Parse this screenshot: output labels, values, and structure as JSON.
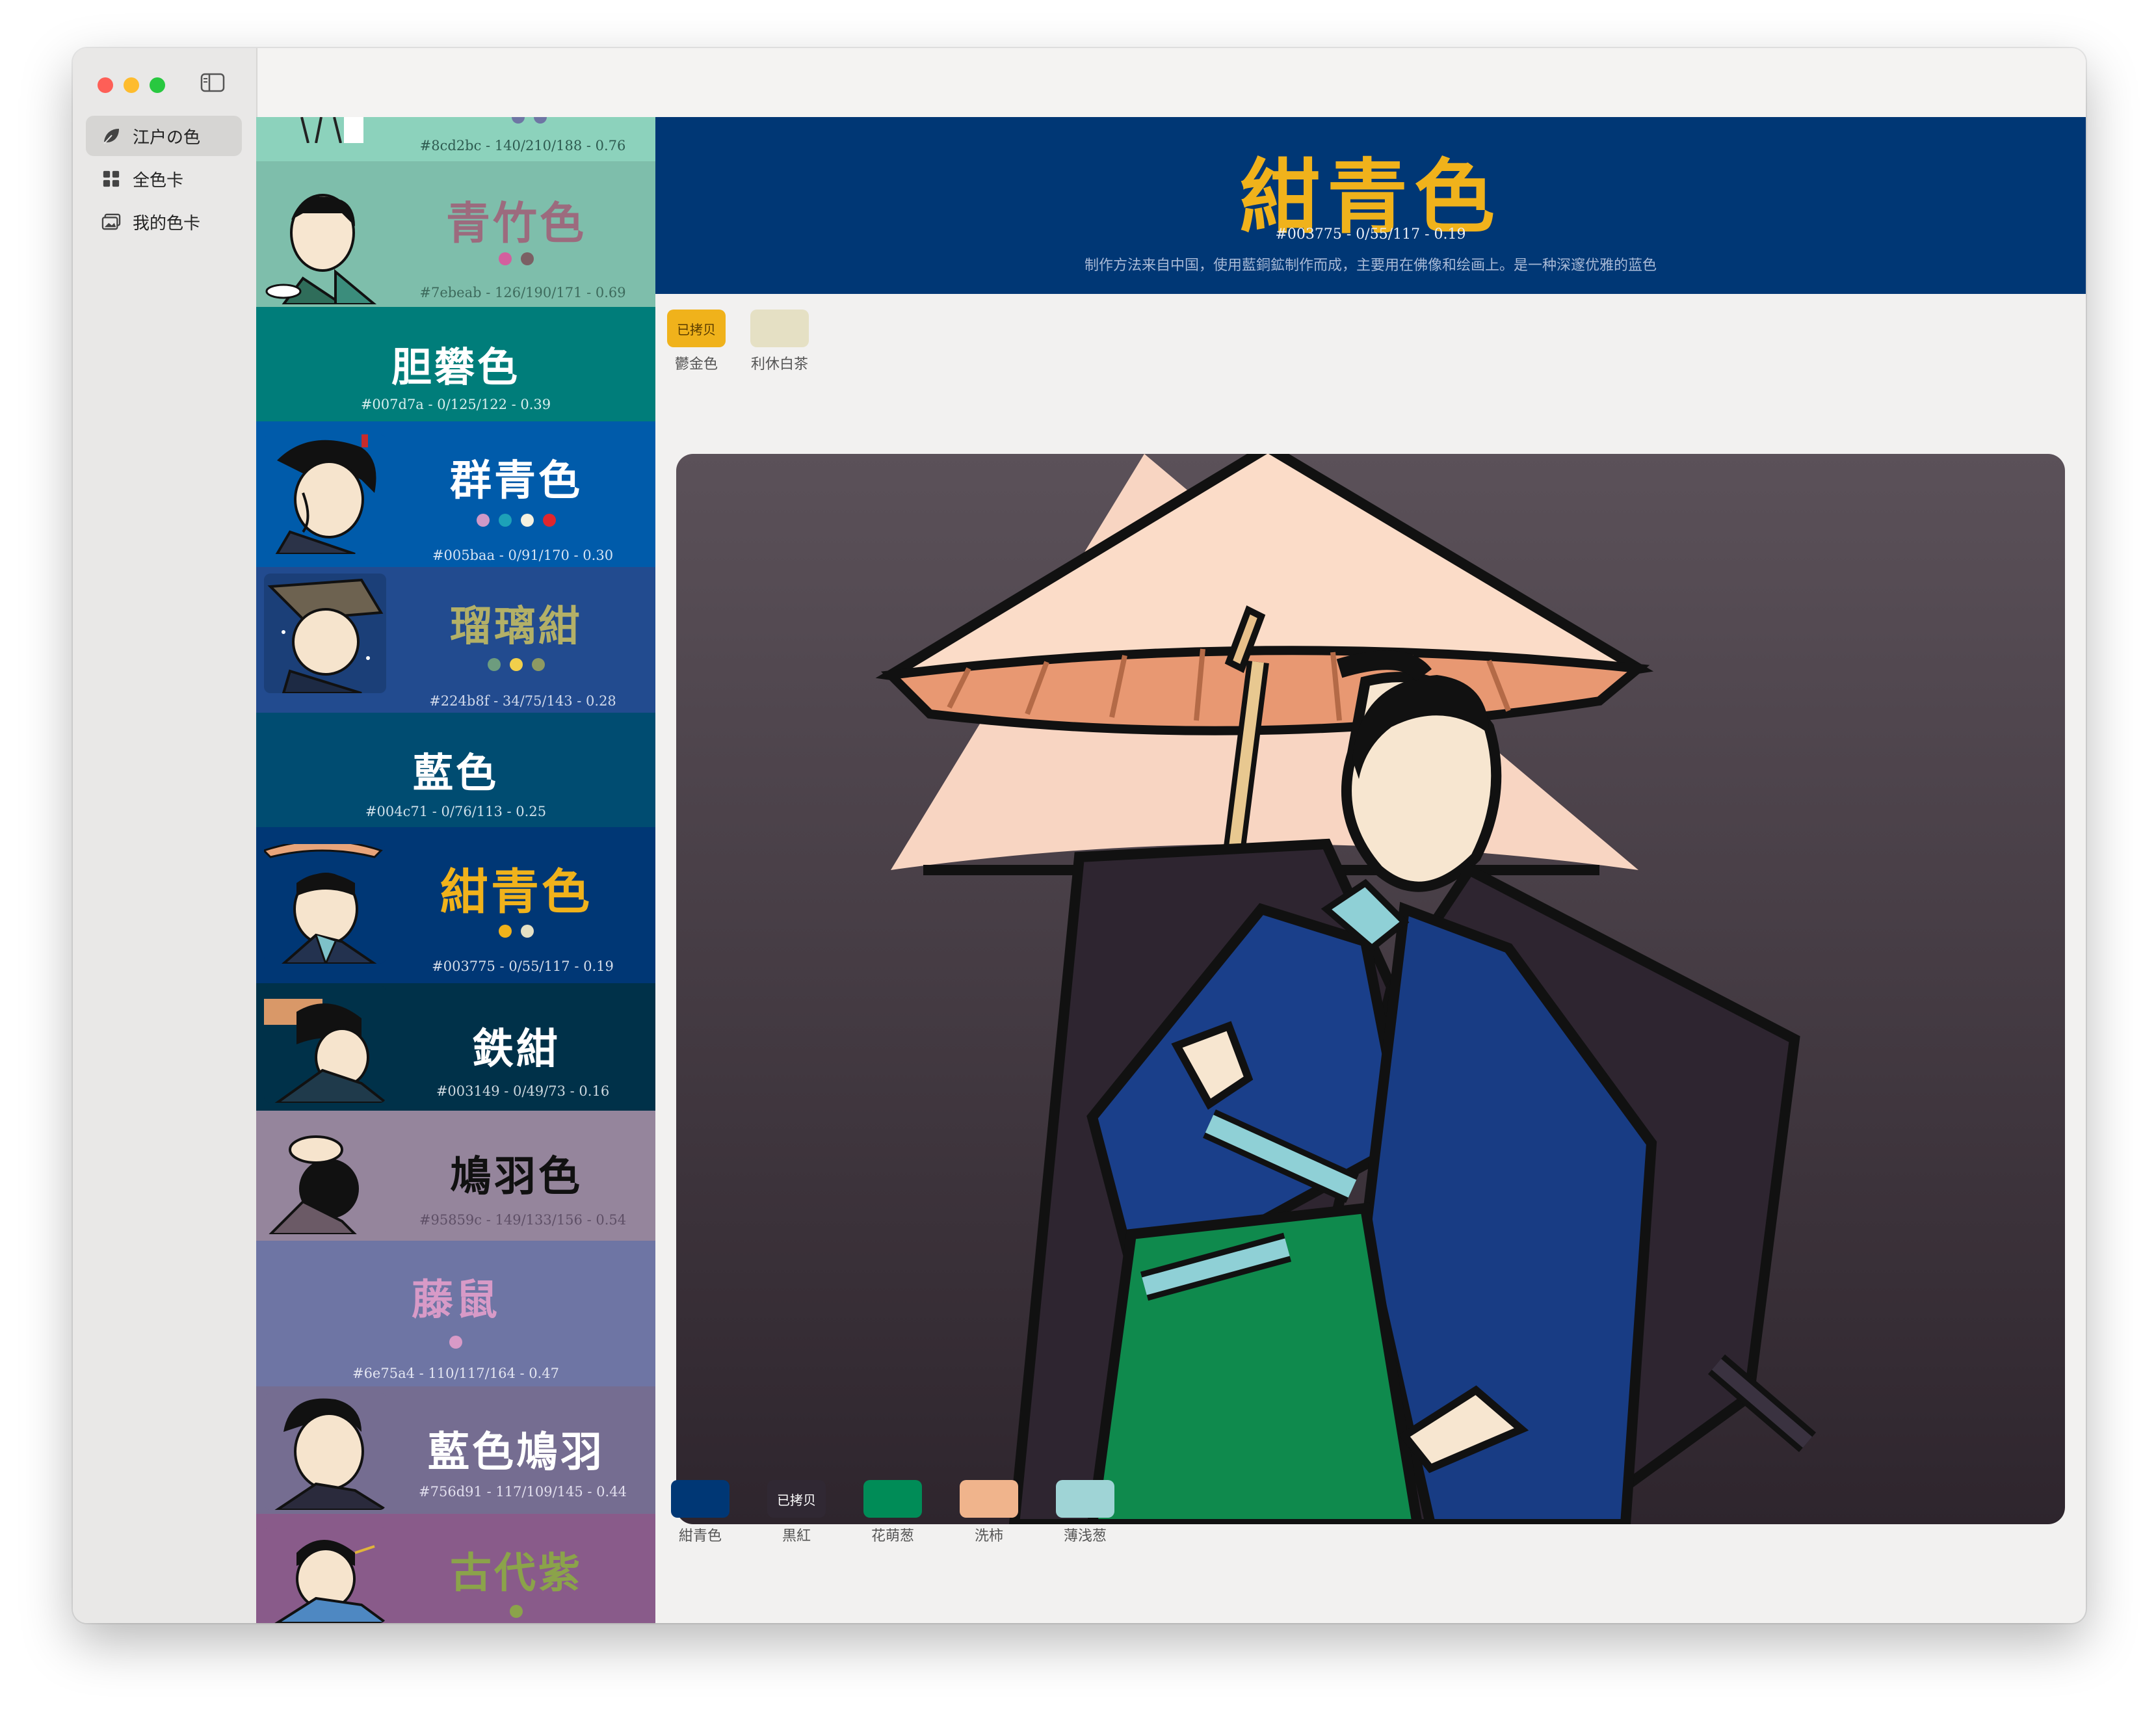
{
  "sidebar": {
    "items": [
      {
        "label": "江户の色",
        "icon": "leaf-icon",
        "active": true
      },
      {
        "label": "全色卡",
        "icon": "grid-icon",
        "active": false
      },
      {
        "label": "我的色卡",
        "icon": "photos-icon",
        "active": false
      }
    ]
  },
  "colors": {
    "list": [
      {
        "meta": "#8cd2bc - 140/210/188 - 0.76"
      },
      {
        "name": "青竹色",
        "meta": "#7ebeab - 126/190/171 - 0.69"
      },
      {
        "name": "胆礬色",
        "meta": "#007d7a - 0/125/122 - 0.39"
      },
      {
        "name": "群青色",
        "meta": "#005baa - 0/91/170 - 0.30"
      },
      {
        "name": "瑠璃紺",
        "meta": "#224b8f - 34/75/143 - 0.28"
      },
      {
        "name": "藍色",
        "meta": "#004c71 - 0/76/113 - 0.25"
      },
      {
        "name": "紺青色",
        "meta": "#003775 - 0/55/117 - 0.19"
      },
      {
        "name": "鉄紺",
        "meta": "#003149 - 0/49/73 - 0.16"
      },
      {
        "name": "鳩羽色",
        "meta": "#95859c - 149/133/156 - 0.54"
      },
      {
        "name": "藤鼠",
        "meta": "#6e75a4 - 110/117/164 - 0.47"
      },
      {
        "name": "藍色鳩羽",
        "meta": "#756d91 - 117/109/145 - 0.44"
      },
      {
        "name": "古代紫"
      }
    ]
  },
  "detail": {
    "title": "紺青色",
    "meta": "#003775 - 0/55/117 - 0.19",
    "description": "制作方法来自中国，使用藍銅鉱制作而成，主要用在佛像和绘画上。是一种深邃优雅的蓝色",
    "top_chips": [
      {
        "label": "鬱金色",
        "badge": "已拷贝",
        "color": "#f0b21b"
      },
      {
        "label": "利休白茶",
        "badge": "",
        "color": "#e5e0c4"
      }
    ],
    "palette": [
      {
        "label": "紺青色",
        "badge": "",
        "color": "#003775"
      },
      {
        "label": "黒紅",
        "badge": "已拷贝",
        "color": "#302833"
      },
      {
        "label": "花萌葱",
        "badge": "",
        "color": "#008c57"
      },
      {
        "label": "洗柿",
        "badge": "",
        "color": "#f0b48c"
      },
      {
        "label": "薄浅葱",
        "badge": "",
        "color": "#9fd4d6"
      }
    ]
  }
}
